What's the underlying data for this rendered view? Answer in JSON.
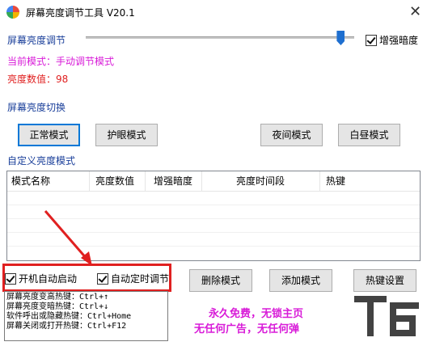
{
  "window": {
    "title": "屏幕亮度调节工具 V20.1",
    "close_glyph": "✕"
  },
  "brightness_adjust": {
    "label": "屏幕亮度调节",
    "slider_level": 0.95,
    "enhance_dark_checked": true,
    "enhance_dark_label": "增强暗度"
  },
  "status": {
    "current_mode": "当前模式：手动调节模式",
    "brightness_value": "亮度数值：98"
  },
  "mode_switch": {
    "label": "屏幕亮度切换",
    "buttons": [
      "正常模式",
      "护眼模式",
      "夜间模式",
      "白昼模式"
    ]
  },
  "custom": {
    "label": "自定义亮度模式",
    "columns": [
      "模式名称",
      "亮度数值",
      "增强暗度",
      "亮度时间段",
      "热键"
    ]
  },
  "options": {
    "autostart_label": "开机自动启动",
    "autostart_checked": true,
    "auto_timer_label": "自动定时调节",
    "auto_timer_checked": true
  },
  "actions": {
    "delete": "删除模式",
    "add": "添加模式",
    "hotkey": "热键设置"
  },
  "hotkey_log": [
    "屏幕亮度变高热键：Ctrl+↑",
    "屏幕亮度变暗热键：Ctrl+↓",
    "软件呼出或隐藏热键：Ctrl+Home",
    "屏幕关闭或打开热键：Ctrl+F12"
  ],
  "promo": {
    "line1": "永久免费，无锁主页",
    "line2": "无任何广告，无任何弹"
  },
  "colors": {
    "blue_label": "#1a3f9a",
    "pink_text": "#d81bd8",
    "red_text": "#e02020",
    "annotation_red": "#e02020",
    "slider_thumb": "#1e6fd0"
  }
}
